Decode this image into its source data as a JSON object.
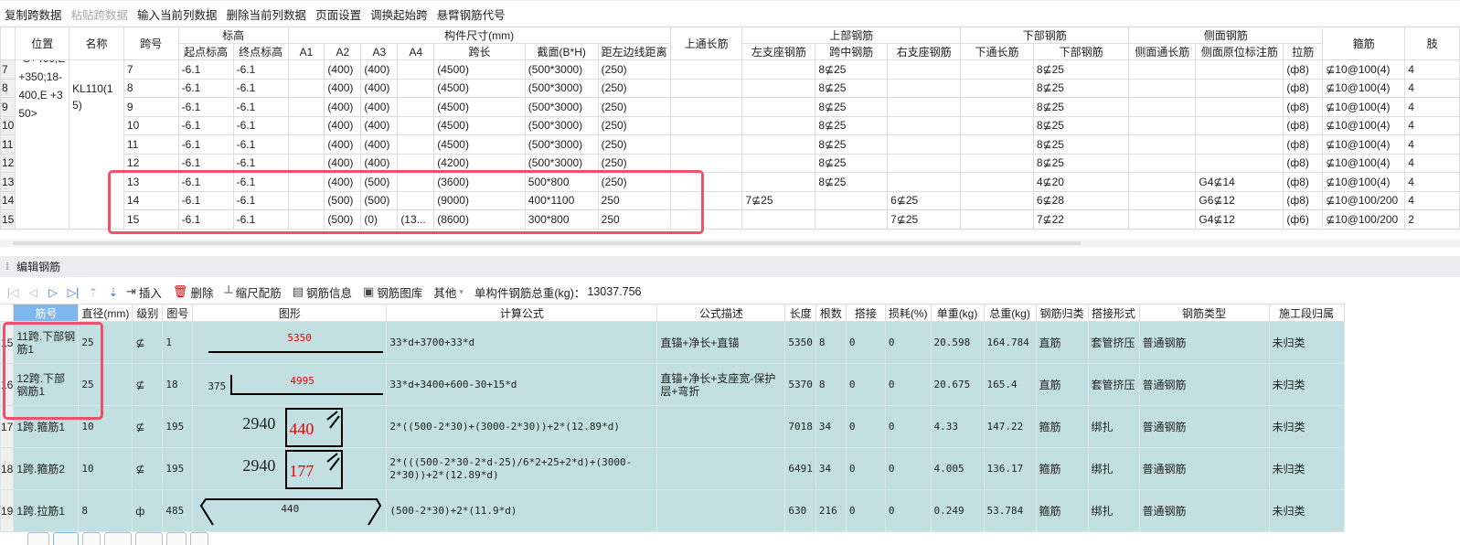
{
  "menu": [
    "复制跨数据",
    "粘贴跨数据",
    "输入当前列数据",
    "删除当前列数据",
    "页面设置",
    "调换起始跨",
    "悬臂钢筋代号"
  ],
  "top_table": {
    "headers": {
      "pos": "位置",
      "name": "名称",
      "span": "跨号",
      "elev": "标高",
      "elev_start": "起点标高",
      "elev_end": "终点标高",
      "dims": "构件尺寸(mm)",
      "a1": "A1",
      "a2": "A2",
      "a3": "A3",
      "a4": "A4",
      "span_len": "跨长",
      "section": "截面(B*H)",
      "dist": "距左边线距离",
      "top_long": "上通长筋",
      "top_bar": "上部钢筋",
      "left_sup": "左支座钢筋",
      "mid": "跨中钢筋",
      "right_sup": "右支座钢筋",
      "bot_bar": "下部钢筋",
      "bot_long": "下通长筋",
      "bot": "下部钢筋",
      "side": "侧面钢筋",
      "side_long": "侧面通长筋",
      "side_orig": "侧面原位标注筋",
      "tie": "拉筋",
      "stirrup": "箍筋",
      "leg": "肢"
    },
    "position_text": "-C+400,E +350;18-400,E +350>",
    "name_text": "KL110(15)",
    "rows": [
      {
        "rn": "7",
        "span": "7",
        "es": "-6.1",
        "ee": "-6.1",
        "a1": "",
        "a2": "(400)",
        "a3": "(400)",
        "a4": "",
        "len": "(4500)",
        "sec": "(500*3000)",
        "dist": "(250)",
        "tl": "",
        "ls": "",
        "mid": "8⊈25",
        "rs": "",
        "bl": "",
        "bot": "8⊈25",
        "sl": "",
        "so": "",
        "tie": "(ф8)",
        "stir": "⊈10@100(4)",
        "leg": "4"
      },
      {
        "rn": "8",
        "span": "8",
        "es": "-6.1",
        "ee": "-6.1",
        "a1": "",
        "a2": "(400)",
        "a3": "(400)",
        "a4": "",
        "len": "(4500)",
        "sec": "(500*3000)",
        "dist": "(250)",
        "tl": "",
        "ls": "",
        "mid": "8⊈25",
        "rs": "",
        "bl": "",
        "bot": "8⊈25",
        "sl": "",
        "so": "",
        "tie": "(ф8)",
        "stir": "⊈10@100(4)",
        "leg": "4"
      },
      {
        "rn": "9",
        "span": "9",
        "es": "-6.1",
        "ee": "-6.1",
        "a1": "",
        "a2": "(400)",
        "a3": "(400)",
        "a4": "",
        "len": "(4500)",
        "sec": "(500*3000)",
        "dist": "(250)",
        "tl": "",
        "ls": "",
        "mid": "8⊈25",
        "rs": "",
        "bl": "",
        "bot": "8⊈25",
        "sl": "",
        "so": "",
        "tie": "(ф8)",
        "stir": "⊈10@100(4)",
        "leg": "4"
      },
      {
        "rn": "10",
        "span": "10",
        "es": "-6.1",
        "ee": "-6.1",
        "a1": "",
        "a2": "(400)",
        "a3": "(400)",
        "a4": "",
        "len": "(4500)",
        "sec": "(500*3000)",
        "dist": "(250)",
        "tl": "",
        "ls": "",
        "mid": "8⊈25",
        "rs": "",
        "bl": "",
        "bot": "8⊈25",
        "sl": "",
        "so": "",
        "tie": "(ф8)",
        "stir": "⊈10@100(4)",
        "leg": "4"
      },
      {
        "rn": "11",
        "span": "11",
        "es": "-6.1",
        "ee": "-6.1",
        "a1": "",
        "a2": "(400)",
        "a3": "(400)",
        "a4": "",
        "len": "(4500)",
        "sec": "(500*3000)",
        "dist": "(250)",
        "tl": "",
        "ls": "",
        "mid": "8⊈25",
        "rs": "",
        "bl": "",
        "bot": "8⊈25",
        "sl": "",
        "so": "",
        "tie": "(ф8)",
        "stir": "⊈10@100(4)",
        "leg": "4"
      },
      {
        "rn": "12",
        "span": "12",
        "es": "-6.1",
        "ee": "-6.1",
        "a1": "",
        "a2": "(400)",
        "a3": "(400)",
        "a4": "",
        "len": "(4200)",
        "sec": "(500*3000)",
        "dist": "(250)",
        "tl": "",
        "ls": "",
        "mid": "8⊈25",
        "rs": "",
        "bl": "",
        "bot": "8⊈25",
        "sl": "",
        "so": "",
        "tie": "(ф8)",
        "stir": "⊈10@100(4)",
        "leg": "4"
      },
      {
        "rn": "13",
        "span": "13",
        "es": "-6.1",
        "ee": "-6.1",
        "a1": "",
        "a2": "(400)",
        "a3": "(500)",
        "a4": "",
        "len": "(3600)",
        "sec": "500*800",
        "dist": "(250)",
        "tl": "",
        "ls": "",
        "mid": "8⊈25",
        "rs": "",
        "bl": "",
        "bot": "4⊈20",
        "sl": "",
        "so": "G4⊈14",
        "tie": "(ф8)",
        "stir": "⊈10@100(4)",
        "leg": "4"
      },
      {
        "rn": "14",
        "span": "14",
        "es": "-6.1",
        "ee": "-6.1",
        "a1": "",
        "a2": "(500)",
        "a3": "(500)",
        "a4": "",
        "len": "(9000)",
        "sec": "400*1100",
        "dist": "250",
        "tl": "",
        "ls": "7⊈25",
        "mid": "",
        "rs": "6⊈25",
        "bl": "",
        "bot": "6⊈28",
        "sl": "",
        "so": "G6⊈12",
        "tie": "(ф8)",
        "stir": "⊈10@100/200",
        "leg": "4"
      },
      {
        "rn": "15",
        "span": "15",
        "es": "-6.1",
        "ee": "-6.1",
        "a1": "",
        "a2": "(500)",
        "a3": "(0)",
        "a4": "(13...",
        "len": "(8600)",
        "sec": "300*800",
        "dist": "250",
        "tl": "",
        "ls": "",
        "mid": "",
        "rs": "7⊈25",
        "bl": "",
        "bot": "7⊈22",
        "sl": "",
        "so": "G4⊈12",
        "tie": "(ф6)",
        "stir": "⊈10@100/200",
        "leg": "2"
      }
    ]
  },
  "panel": {
    "title": "编辑钢筋"
  },
  "toolbar": {
    "insert": "插入",
    "delete": "删除",
    "scale": "缩尺配筋",
    "info": "钢筋信息",
    "library": "钢筋图库",
    "other": "其他",
    "total_label": "单构件钢筋总重(kg)：",
    "total_value": "13037.756"
  },
  "bottom_table": {
    "headers": [
      "筋号",
      "直径(mm)",
      "级别",
      "图号",
      "图形",
      "计算公式",
      "公式描述",
      "长度",
      "根数",
      "搭接",
      "损耗(%)",
      "单重(kg)",
      "总重(kg)",
      "钢筋归类",
      "搭接形式",
      "钢筋类型",
      "施工段归属"
    ],
    "rows": [
      {
        "rn": "15",
        "name": "11跨.下部钢筋1",
        "dia": "25",
        "grade": "⊈",
        "fig": "1",
        "shape": {
          "type": "straight",
          "main": "5350"
        },
        "formula": "33*d+3700+33*d",
        "desc": "直锚+净长+直锚",
        "len": "5350",
        "count": "8",
        "lap": "0",
        "loss": "0",
        "unit": "20.598",
        "total": "164.784",
        "cls": "直筋",
        "lapform": "套管挤压",
        "type": "普通钢筋",
        "stage": "未归类"
      },
      {
        "rn": "16",
        "name": "12跨.下部钢筋1",
        "dia": "25",
        "grade": "⊈",
        "fig": "18",
        "shape": {
          "type": "hook",
          "main": "4995",
          "side": "375"
        },
        "formula": "33*d+3400+600-30+15*d",
        "desc": "直锚+净长+支座宽-保护层+弯折",
        "len": "5370",
        "count": "8",
        "lap": "0",
        "loss": "0",
        "unit": "20.675",
        "total": "165.4",
        "cls": "直筋",
        "lapform": "套管挤压",
        "type": "普通钢筋",
        "stage": "未归类"
      },
      {
        "rn": "17",
        "name": "1跨.箍筋1",
        "dia": "10",
        "grade": "⊈",
        "fig": "195",
        "shape": {
          "type": "stirrup",
          "main": "2940",
          "side": "440"
        },
        "formula": "2*((500-2*30)+(3000-2*30))+2*(12.89*d)",
        "desc": "",
        "len": "7018",
        "count": "34",
        "lap": "0",
        "loss": "0",
        "unit": "4.33",
        "total": "147.22",
        "cls": "箍筋",
        "lapform": "绑扎",
        "type": "普通钢筋",
        "stage": "未归类"
      },
      {
        "rn": "18",
        "name": "1跨.箍筋2",
        "dia": "10",
        "grade": "⊈",
        "fig": "195",
        "shape": {
          "type": "stirrup",
          "main": "2940",
          "side": "177"
        },
        "formula": "2*(((500-2*30-2*d-25)/6*2+25+2*d)+(3000-2*30))+2*(12.89*d)",
        "desc": "",
        "len": "6491",
        "count": "34",
        "lap": "0",
        "loss": "0",
        "unit": "4.005",
        "total": "136.17",
        "cls": "箍筋",
        "lapform": "绑扎",
        "type": "普通钢筋",
        "stage": "未归类"
      },
      {
        "rn": "19",
        "name": "1跨.拉筋1",
        "dia": "8",
        "grade": "ф",
        "fig": "485",
        "shape": {
          "type": "tie",
          "main": "440"
        },
        "formula": "(500-2*30)+2*(11.9*d)",
        "desc": "",
        "len": "630",
        "count": "216",
        "lap": "0",
        "loss": "0",
        "unit": "0.249",
        "total": "53.784",
        "cls": "箍筋",
        "lapform": "绑扎",
        "type": "普通钢筋",
        "stage": "未归类"
      }
    ]
  },
  "colors": {
    "highlight": "#f0506a",
    "row_bg": "#c2dfe1",
    "header_sel": "#7eb6ef",
    "dim_red": "#ee0000"
  }
}
